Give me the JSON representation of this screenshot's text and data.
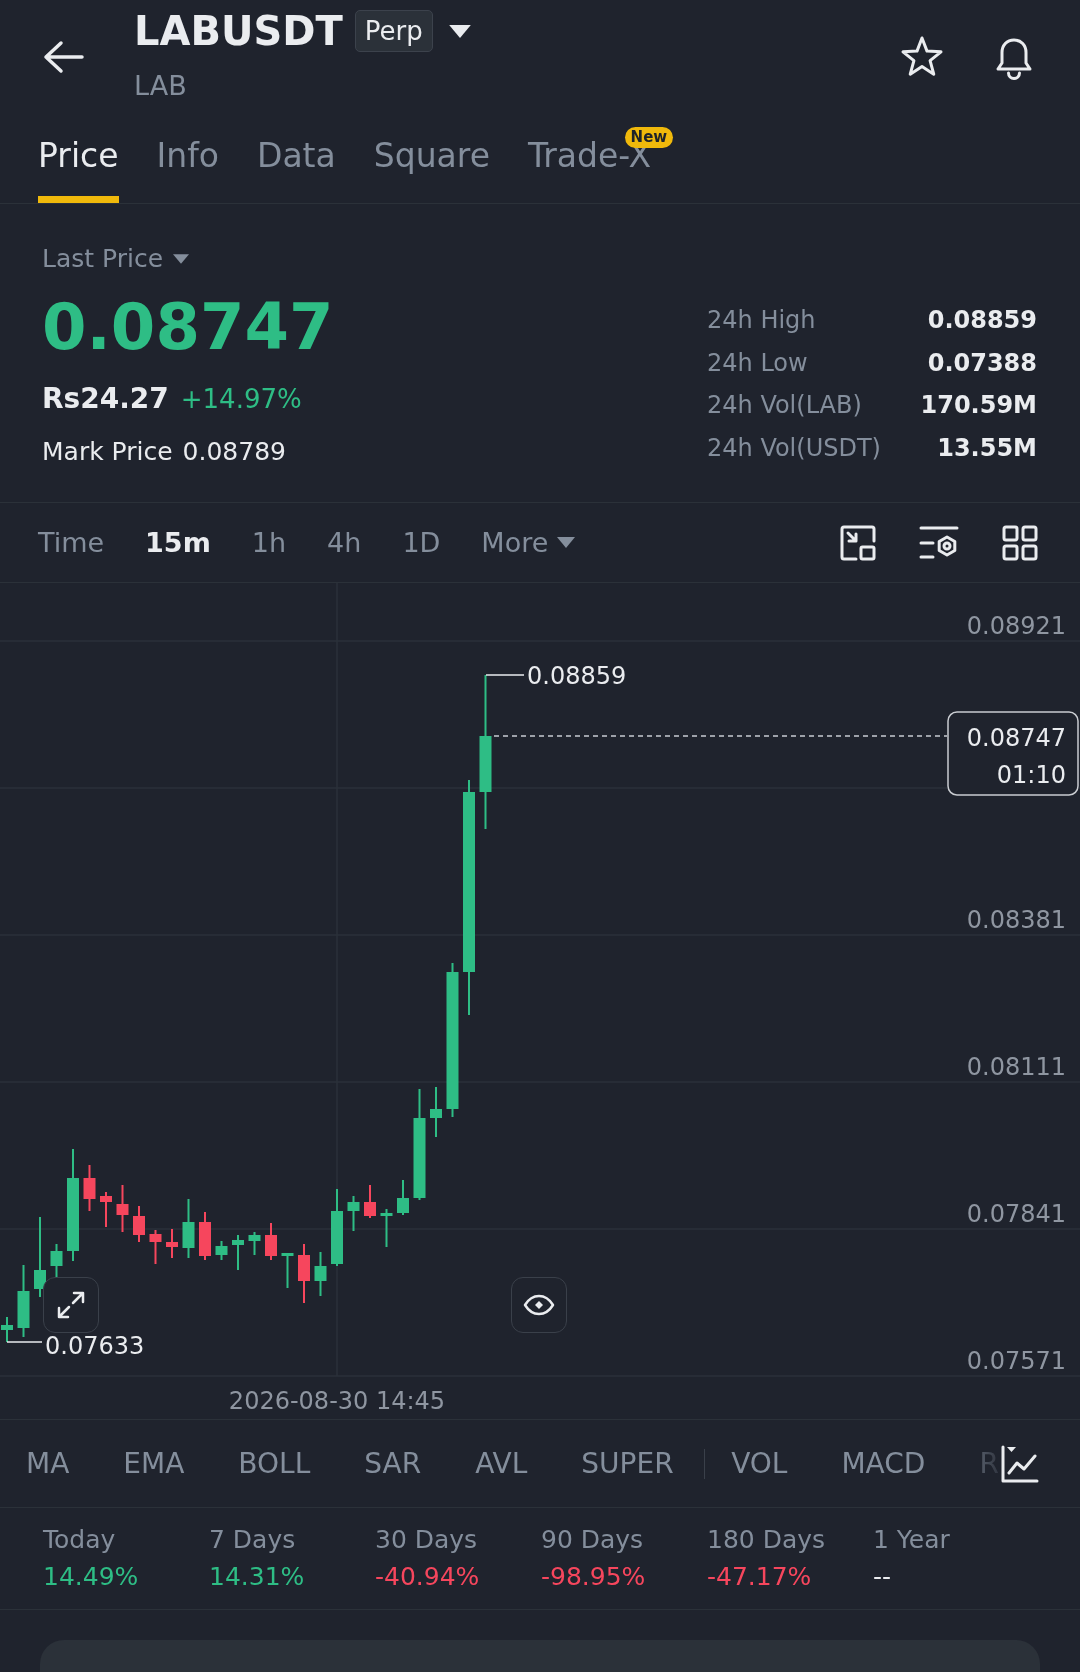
{
  "header": {
    "symbol": "LABUSDT",
    "contract_badge": "Perp",
    "base_asset": "LAB",
    "favorite": false
  },
  "tabs": [
    {
      "label": "Price",
      "selected": true
    },
    {
      "label": "Info",
      "selected": false
    },
    {
      "label": "Data",
      "selected": false
    },
    {
      "label": "Square",
      "selected": false
    },
    {
      "label": "Trade-X",
      "selected": false,
      "badge": "New"
    }
  ],
  "price": {
    "mode_label": "Last Price",
    "last_price": "0.08747",
    "local_price": "Rs24.27",
    "change": "+14.97%",
    "mark_price_label": "Mark Price",
    "mark_price": "0.08789"
  },
  "stats": [
    {
      "label": "24h High",
      "value": "0.08859"
    },
    {
      "label": "24h Low",
      "value": "0.07388"
    },
    {
      "label": "24h Vol(LAB)",
      "value": "170.59M"
    },
    {
      "label": "24h Vol(USDT)",
      "value": "13.55M"
    }
  ],
  "intervals": [
    {
      "label": "Time",
      "kind": "option",
      "selected": false
    },
    {
      "label": "15m",
      "kind": "option",
      "selected": true
    },
    {
      "label": "1h",
      "kind": "option",
      "selected": false
    },
    {
      "label": "4h",
      "kind": "option",
      "selected": false
    },
    {
      "label": "1D",
      "kind": "option",
      "selected": false
    },
    {
      "label": "More",
      "kind": "menu",
      "selected": false
    }
  ],
  "chart": {
    "price_axis": [
      "0.08921",
      "0.08381",
      "0.08111",
      "0.07841",
      "0.07571"
    ],
    "high_label": "0.08859",
    "low_label": "0.07633",
    "last_price": "0.08747",
    "countdown": "01:10",
    "time_label": "2026-08-30 14:45"
  },
  "indicators": {
    "main": [
      "MA",
      "EMA",
      "BOLL",
      "SAR",
      "AVL",
      "SUPER"
    ],
    "sub": [
      "VOL",
      "MACD",
      "R"
    ]
  },
  "periods": [
    {
      "label": "Today",
      "value": "14.49%",
      "color": "#2ebd85"
    },
    {
      "label": "7 Days",
      "value": "14.31%",
      "color": "#2ebd85"
    },
    {
      "label": "30 Days",
      "value": "-40.94%",
      "color": "#f6465d"
    },
    {
      "label": "90 Days",
      "value": "-98.95%",
      "color": "#f6465d"
    },
    {
      "label": "180 Days",
      "value": "-47.17%",
      "color": "#f6465d"
    },
    {
      "label": "1 Year",
      "value": "--",
      "color": "#eaecef"
    }
  ]
}
